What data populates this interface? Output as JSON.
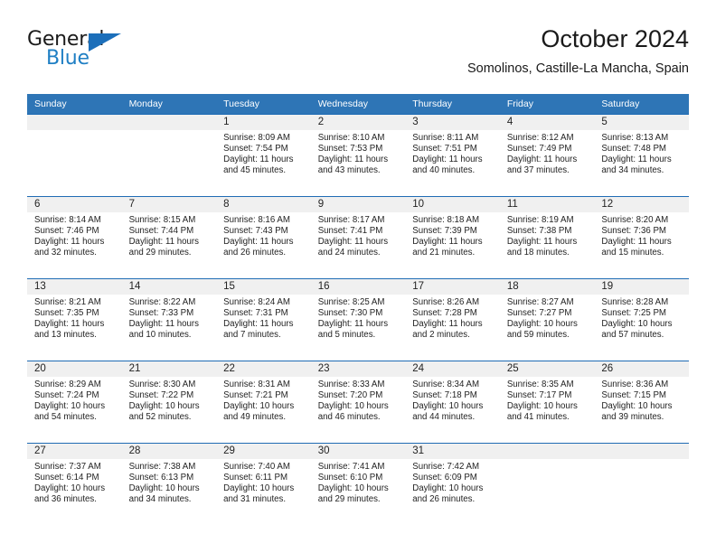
{
  "brand": {
    "name_part1": "General",
    "name_part2": "Blue",
    "logo_icon": "triangle-logo-icon",
    "accent_color": "#1c6fba"
  },
  "header": {
    "title": "October 2024",
    "subtitle": "Somolinos, Castille-La Mancha, Spain"
  },
  "calendar": {
    "header_bg": "#2e75b6",
    "rule_color": "#1f6cb4",
    "daynum_band_bg": "#f0f0f0",
    "weekday_headers": [
      "Sunday",
      "Monday",
      "Tuesday",
      "Wednesday",
      "Thursday",
      "Friday",
      "Saturday"
    ],
    "weeks": [
      [
        {
          "day": "",
          "lines": []
        },
        {
          "day": "",
          "lines": []
        },
        {
          "day": "1",
          "lines": [
            "Sunrise: 8:09 AM",
            "Sunset: 7:54 PM",
            "Daylight: 11 hours",
            "and 45 minutes."
          ]
        },
        {
          "day": "2",
          "lines": [
            "Sunrise: 8:10 AM",
            "Sunset: 7:53 PM",
            "Daylight: 11 hours",
            "and 43 minutes."
          ]
        },
        {
          "day": "3",
          "lines": [
            "Sunrise: 8:11 AM",
            "Sunset: 7:51 PM",
            "Daylight: 11 hours",
            "and 40 minutes."
          ]
        },
        {
          "day": "4",
          "lines": [
            "Sunrise: 8:12 AM",
            "Sunset: 7:49 PM",
            "Daylight: 11 hours",
            "and 37 minutes."
          ]
        },
        {
          "day": "5",
          "lines": [
            "Sunrise: 8:13 AM",
            "Sunset: 7:48 PM",
            "Daylight: 11 hours",
            "and 34 minutes."
          ]
        }
      ],
      [
        {
          "day": "6",
          "lines": [
            "Sunrise: 8:14 AM",
            "Sunset: 7:46 PM",
            "Daylight: 11 hours",
            "and 32 minutes."
          ]
        },
        {
          "day": "7",
          "lines": [
            "Sunrise: 8:15 AM",
            "Sunset: 7:44 PM",
            "Daylight: 11 hours",
            "and 29 minutes."
          ]
        },
        {
          "day": "8",
          "lines": [
            "Sunrise: 8:16 AM",
            "Sunset: 7:43 PM",
            "Daylight: 11 hours",
            "and 26 minutes."
          ]
        },
        {
          "day": "9",
          "lines": [
            "Sunrise: 8:17 AM",
            "Sunset: 7:41 PM",
            "Daylight: 11 hours",
            "and 24 minutes."
          ]
        },
        {
          "day": "10",
          "lines": [
            "Sunrise: 8:18 AM",
            "Sunset: 7:39 PM",
            "Daylight: 11 hours",
            "and 21 minutes."
          ]
        },
        {
          "day": "11",
          "lines": [
            "Sunrise: 8:19 AM",
            "Sunset: 7:38 PM",
            "Daylight: 11 hours",
            "and 18 minutes."
          ]
        },
        {
          "day": "12",
          "lines": [
            "Sunrise: 8:20 AM",
            "Sunset: 7:36 PM",
            "Daylight: 11 hours",
            "and 15 minutes."
          ]
        }
      ],
      [
        {
          "day": "13",
          "lines": [
            "Sunrise: 8:21 AM",
            "Sunset: 7:35 PM",
            "Daylight: 11 hours",
            "and 13 minutes."
          ]
        },
        {
          "day": "14",
          "lines": [
            "Sunrise: 8:22 AM",
            "Sunset: 7:33 PM",
            "Daylight: 11 hours",
            "and 10 minutes."
          ]
        },
        {
          "day": "15",
          "lines": [
            "Sunrise: 8:24 AM",
            "Sunset: 7:31 PM",
            "Daylight: 11 hours",
            "and 7 minutes."
          ]
        },
        {
          "day": "16",
          "lines": [
            "Sunrise: 8:25 AM",
            "Sunset: 7:30 PM",
            "Daylight: 11 hours",
            "and 5 minutes."
          ]
        },
        {
          "day": "17",
          "lines": [
            "Sunrise: 8:26 AM",
            "Sunset: 7:28 PM",
            "Daylight: 11 hours",
            "and 2 minutes."
          ]
        },
        {
          "day": "18",
          "lines": [
            "Sunrise: 8:27 AM",
            "Sunset: 7:27 PM",
            "Daylight: 10 hours",
            "and 59 minutes."
          ]
        },
        {
          "day": "19",
          "lines": [
            "Sunrise: 8:28 AM",
            "Sunset: 7:25 PM",
            "Daylight: 10 hours",
            "and 57 minutes."
          ]
        }
      ],
      [
        {
          "day": "20",
          "lines": [
            "Sunrise: 8:29 AM",
            "Sunset: 7:24 PM",
            "Daylight: 10 hours",
            "and 54 minutes."
          ]
        },
        {
          "day": "21",
          "lines": [
            "Sunrise: 8:30 AM",
            "Sunset: 7:22 PM",
            "Daylight: 10 hours",
            "and 52 minutes."
          ]
        },
        {
          "day": "22",
          "lines": [
            "Sunrise: 8:31 AM",
            "Sunset: 7:21 PM",
            "Daylight: 10 hours",
            "and 49 minutes."
          ]
        },
        {
          "day": "23",
          "lines": [
            "Sunrise: 8:33 AM",
            "Sunset: 7:20 PM",
            "Daylight: 10 hours",
            "and 46 minutes."
          ]
        },
        {
          "day": "24",
          "lines": [
            "Sunrise: 8:34 AM",
            "Sunset: 7:18 PM",
            "Daylight: 10 hours",
            "and 44 minutes."
          ]
        },
        {
          "day": "25",
          "lines": [
            "Sunrise: 8:35 AM",
            "Sunset: 7:17 PM",
            "Daylight: 10 hours",
            "and 41 minutes."
          ]
        },
        {
          "day": "26",
          "lines": [
            "Sunrise: 8:36 AM",
            "Sunset: 7:15 PM",
            "Daylight: 10 hours",
            "and 39 minutes."
          ]
        }
      ],
      [
        {
          "day": "27",
          "lines": [
            "Sunrise: 7:37 AM",
            "Sunset: 6:14 PM",
            "Daylight: 10 hours",
            "and 36 minutes."
          ]
        },
        {
          "day": "28",
          "lines": [
            "Sunrise: 7:38 AM",
            "Sunset: 6:13 PM",
            "Daylight: 10 hours",
            "and 34 minutes."
          ]
        },
        {
          "day": "29",
          "lines": [
            "Sunrise: 7:40 AM",
            "Sunset: 6:11 PM",
            "Daylight: 10 hours",
            "and 31 minutes."
          ]
        },
        {
          "day": "30",
          "lines": [
            "Sunrise: 7:41 AM",
            "Sunset: 6:10 PM",
            "Daylight: 10 hours",
            "and 29 minutes."
          ]
        },
        {
          "day": "31",
          "lines": [
            "Sunrise: 7:42 AM",
            "Sunset: 6:09 PM",
            "Daylight: 10 hours",
            "and 26 minutes."
          ]
        },
        {
          "day": "",
          "lines": []
        },
        {
          "day": "",
          "lines": []
        }
      ]
    ]
  }
}
